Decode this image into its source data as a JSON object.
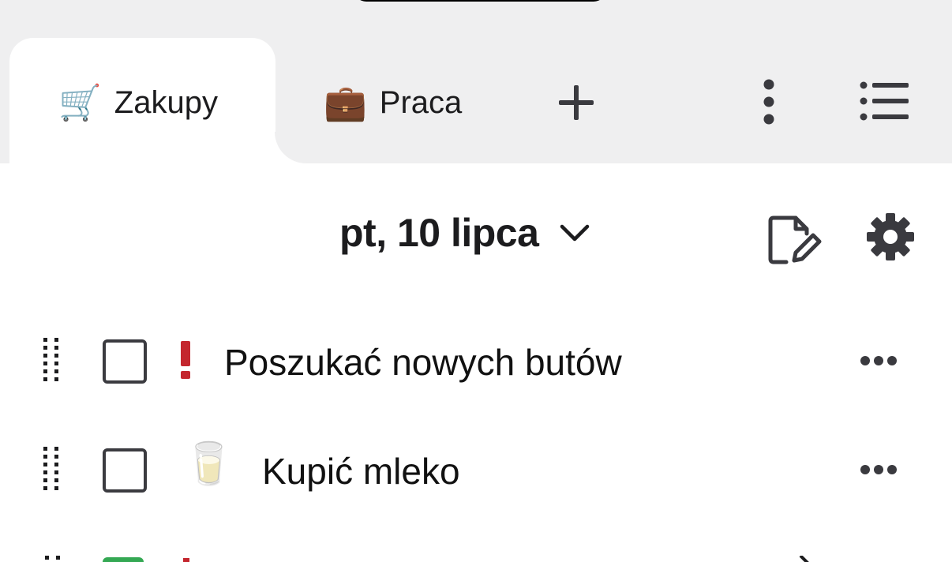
{
  "tabs": [
    {
      "emoji": "🛒",
      "label": "Zakupy",
      "active": true
    },
    {
      "emoji": "💼",
      "label": "Praca",
      "active": false
    }
  ],
  "header": {
    "date": "pt, 10 lipca"
  },
  "tasks": [
    {
      "text": "Poszukać nowych butów",
      "priority": true,
      "emoji": "",
      "checked": false
    },
    {
      "text": "Kupić mleko",
      "priority": false,
      "emoji": "🥛",
      "checked": false
    }
  ],
  "colors": {
    "tab_bar_bg": "#efeff0",
    "priority": "#c4262e",
    "checkbox_border": "#3b3b40",
    "icon": "#3a3a3f",
    "partial_checkbox": "#34a853"
  }
}
